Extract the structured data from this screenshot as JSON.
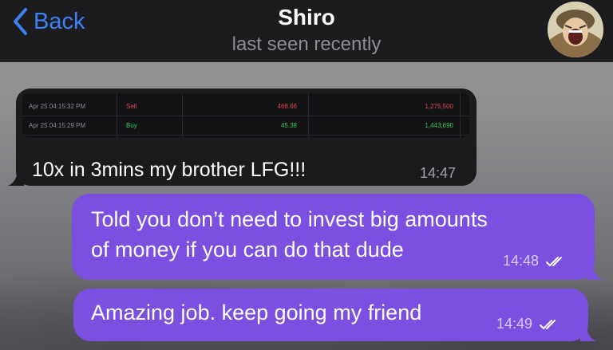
{
  "header": {
    "back_label": "Back",
    "contact_name": "Shiro",
    "status": "last seen recently"
  },
  "messages": [
    {
      "direction": "incoming",
      "attachment": {
        "rows": [
          {
            "date": "Apr 25 04:15:32 PM",
            "side": "Sell",
            "price": "468.66",
            "amount": "1,275,500"
          },
          {
            "date": "Apr 25 04:15:29 PM",
            "side": "Buy",
            "price": "45.38",
            "amount": "1,443,690"
          }
        ]
      },
      "text": "10x in 3mins my brother LFG!!!",
      "time": "14:47"
    },
    {
      "direction": "outgoing",
      "line1": "Told you don’t need to invest big amounts",
      "line2": "of money if you can do that dude",
      "time": "14:48",
      "status_icon": "double-check-icon"
    },
    {
      "direction": "outgoing",
      "line1": "Amazing job. keep going my friend",
      "time": "14:49",
      "status_icon": "double-check-icon"
    }
  ],
  "colors": {
    "header_bg": "#1c1c1e",
    "accent": "#3b82f6",
    "outgoing_bubble": "#7b4fe0",
    "incoming_bubble": "#1b1b1d",
    "sell": "#e0464e",
    "buy": "#34c759"
  }
}
